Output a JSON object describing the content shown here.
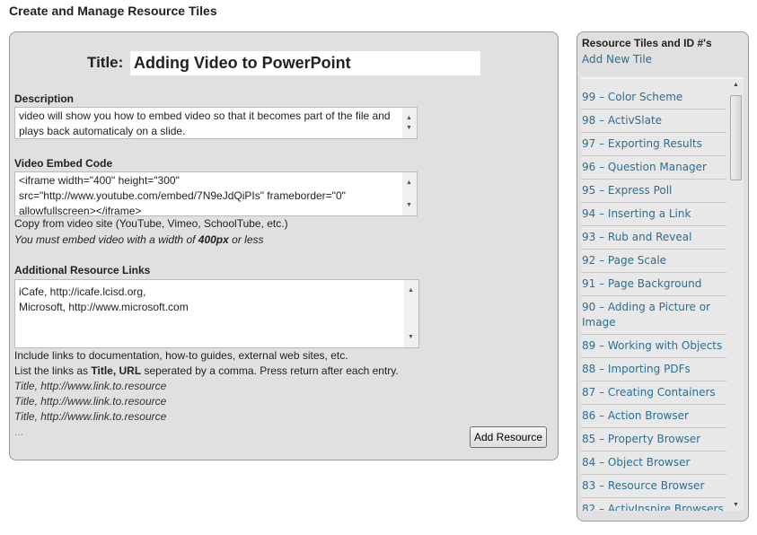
{
  "page_title": "Create and Manage Resource Tiles",
  "form": {
    "title_label": "Title:",
    "title_value": "Adding Video to PowerPoint",
    "description_label": "Description",
    "description_value": "video will show you how to embed video so that it becomes part of the file and plays back automaticaly on a slide.",
    "embed_label": "Video Embed Code",
    "embed_value": "<iframe width=\"400\" height=\"300\" src=\"http://www.youtube.com/embed/7N9eJdQiPIs\" frameborder=\"0\" allowfullscreen></iframe>",
    "embed_note": "Copy from video site (YouTube, Vimeo, SchoolTube, etc.)",
    "embed_warn_pre": "You must embed video with a width of ",
    "embed_warn_bold": "400px",
    "embed_warn_post": " or less",
    "links_label": "Additional Resource Links",
    "links_value": "iCafe, http://icafe.lcisd.org,\nMicrosoft, http://www.microsoft.com",
    "links_note1": "Include links to documentation, how-to guides, external web sites, etc.",
    "links_note2_pre": "List the links as ",
    "links_note2_bold": "Title, URL",
    "links_note2_post": " seperated by a comma. Press return after each entry.",
    "examples": [
      "Title, http://www.link.to.resource",
      "Title, http://www.link.to.resource",
      "Title, http://www.link.to.resource"
    ],
    "ellipsis": "...",
    "submit_label": "Add Resource"
  },
  "sidebar": {
    "title": "Resource Tiles and ID #'s",
    "add_link": "Add New Tile",
    "link_color": "#2a6f96",
    "items": [
      "99 – Color Scheme",
      "98 – ActivSlate",
      "97 – Exporting Results",
      "96 – Question Manager",
      "95 – Express Poll",
      "94 – Inserting a Link",
      "93 – Rub and Reveal",
      "92 – Page Scale",
      "91 – Page Background",
      "90 – Adding a Picture or Image",
      "89 – Working with Objects",
      "88 – Importing PDFs",
      "87 – Creating Containers",
      "86 – Action Browser",
      "85 – Property Browser",
      "84 – Object Browser",
      "83 – Resource Browser",
      "82 – ActivInspire Browsers"
    ]
  }
}
